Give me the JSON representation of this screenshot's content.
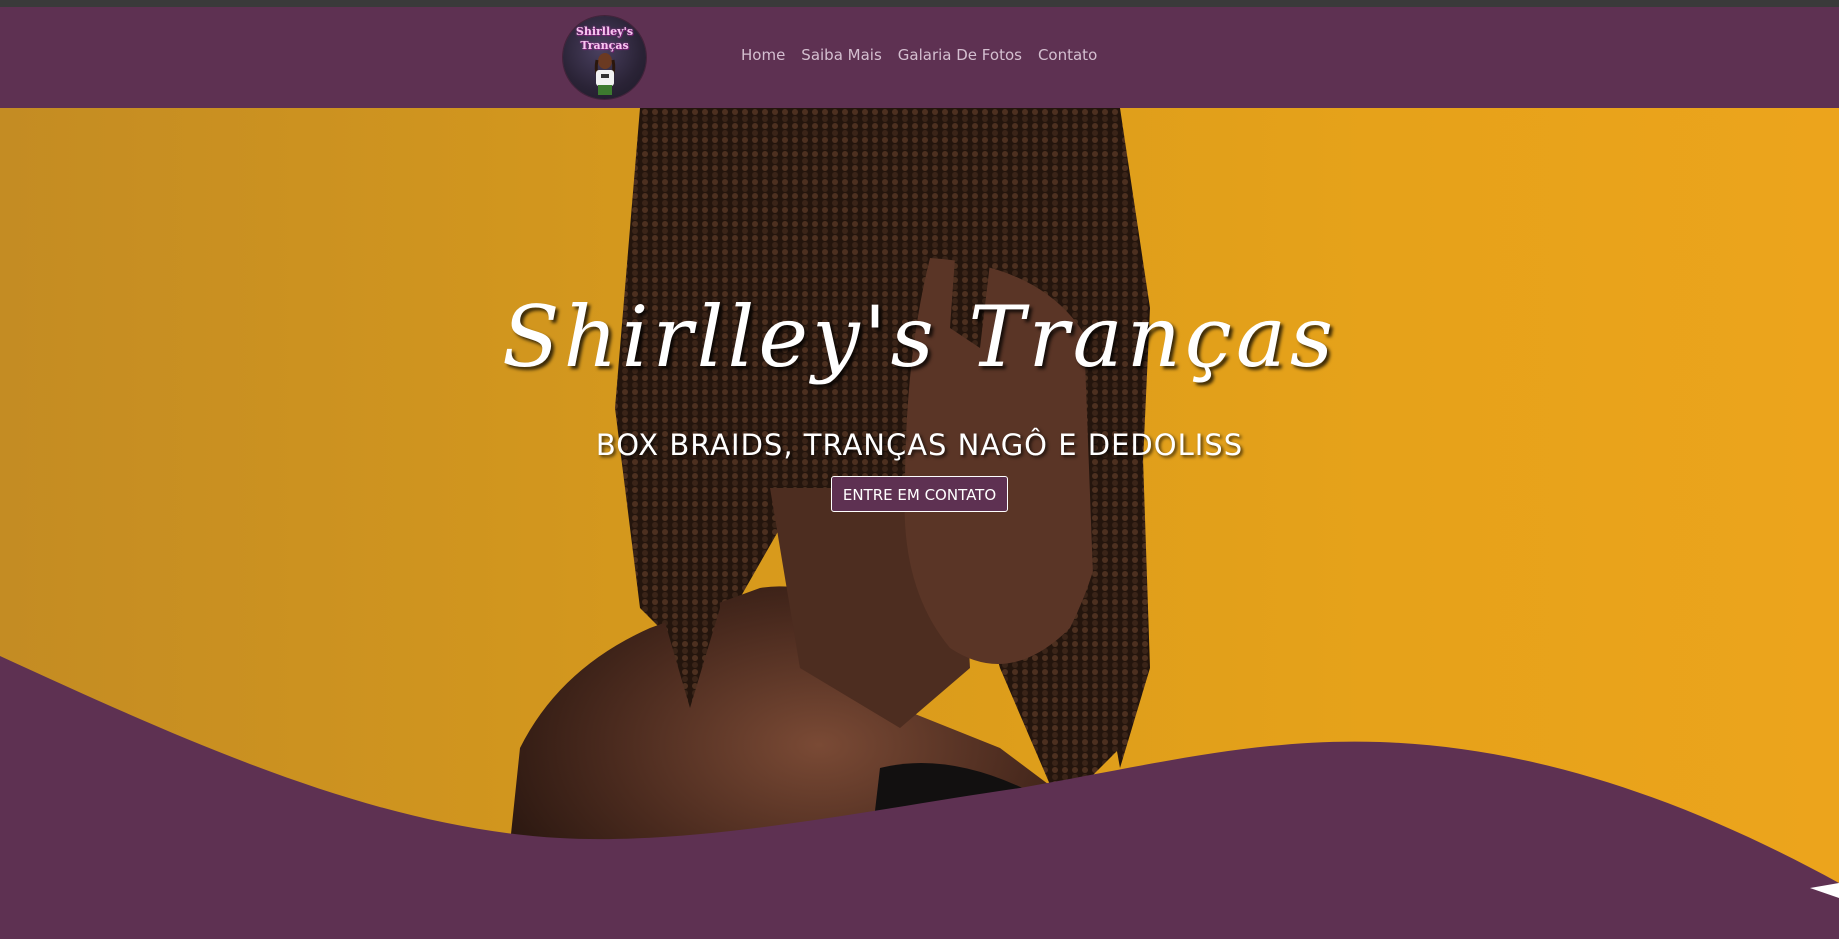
{
  "brand": {
    "logo_line1": "Shirlley's",
    "logo_line2": "Tranças"
  },
  "nav": {
    "items": [
      {
        "label": "Home"
      },
      {
        "label": "Saiba Mais"
      },
      {
        "label": "Galaria De Fotos"
      },
      {
        "label": "Contato"
      }
    ]
  },
  "hero": {
    "title": "Shirlley's Tranças",
    "subtitle": "BOX BRAIDS, TRANÇAS NAGÔ E DEDOLISS",
    "cta_label": "ENTRE EM CONTATO"
  },
  "colors": {
    "brand_purple": "#5e3152",
    "hero_gold": "#e6a21a",
    "nav_text": "#d4bfd0",
    "text_white": "#ffffff"
  }
}
